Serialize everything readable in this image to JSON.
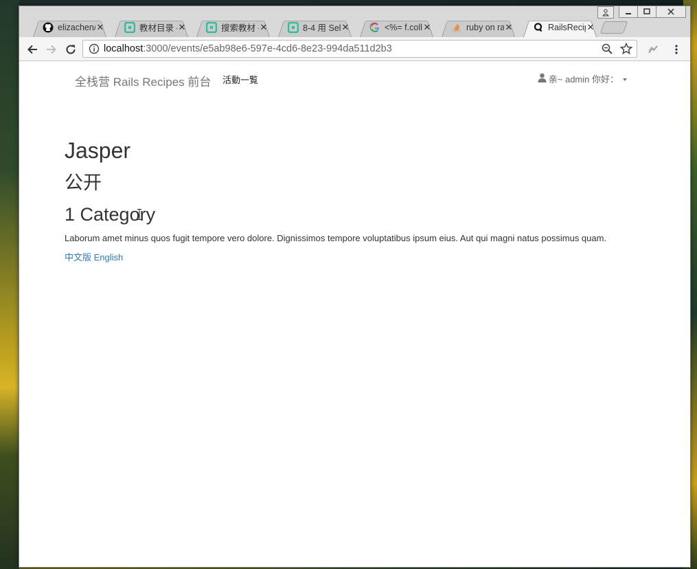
{
  "browser": {
    "tabs": [
      {
        "title": "elizachen/",
        "icon": "github-icon",
        "active": false
      },
      {
        "title": "教材目录 -",
        "icon": "quickbooks-icon",
        "active": false
      },
      {
        "title": "搜索教材 -",
        "icon": "quickbooks-icon",
        "active": false
      },
      {
        "title": "8-4 用 Sel",
        "icon": "quickbooks-icon",
        "active": false
      },
      {
        "title": "<%= f.coll",
        "icon": "google-icon",
        "active": false
      },
      {
        "title": "ruby on ra",
        "icon": "stackoverflow-icon",
        "active": false
      },
      {
        "title": "RailsRecip",
        "icon": "rails-q-icon",
        "active": true
      }
    ],
    "url_host": "localhost",
    "url_path": ":3000/events/e5ab98e6-597e-4cd6-8e23-994da511d2b3"
  },
  "navbar": {
    "brand": "全栈营 Rails Recipes 前台",
    "events_link": "活動一覧",
    "user_label": "亲~ admin 你好："
  },
  "event": {
    "name": "Jasper",
    "status": "公开",
    "category": "1 Category",
    "description": "Laborum amet minus quos fugit tempore vero dolore. Dignissimos tempore voluptatibus ipsum eius. Aut qui magni natus possimus quam.",
    "lang_zh": "中文版",
    "lang_en": "English"
  }
}
